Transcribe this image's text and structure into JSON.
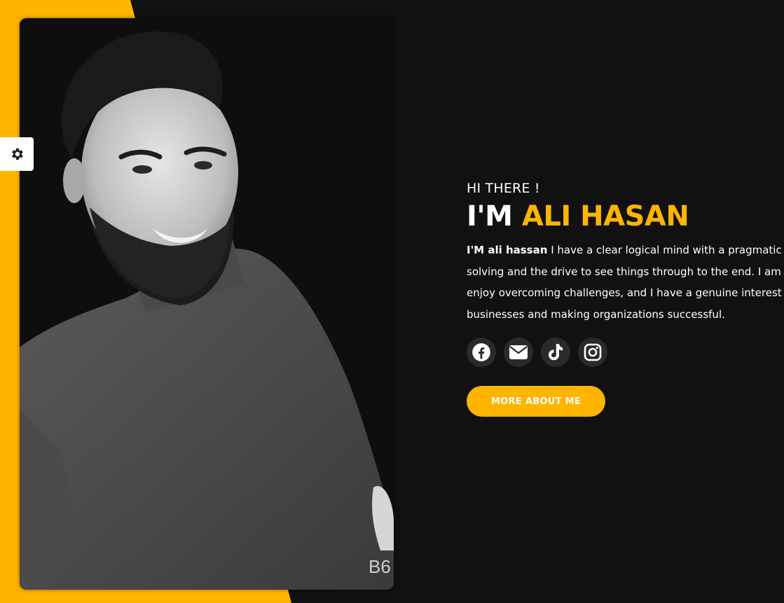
{
  "settings": {
    "icon": "gear-icon"
  },
  "photo": {
    "description_hidden": false,
    "watermark": "B6"
  },
  "hero": {
    "greeting": "HI THERE !",
    "title_prefix": "I'M",
    "title_name": "ALI HASAN",
    "bio_bold": "I'M ali hassan",
    "bio_lines": [
      " I have a clear logical mind with a pragmatic approach to problem",
      "solving and the drive to see things through to the end. I am eager to learn,",
      "enjoy overcoming challenges, and I have a genuine interest in running",
      "businesses and making organizations successful."
    ],
    "socials": [
      {
        "name": "facebook",
        "icon": "facebook-icon"
      },
      {
        "name": "email",
        "icon": "envelope-icon"
      },
      {
        "name": "tiktok",
        "icon": "tiktok-icon"
      },
      {
        "name": "instagram",
        "icon": "instagram-icon"
      }
    ],
    "cta_label": "MORE ABOUT ME"
  },
  "colors": {
    "accent": "#ffb400",
    "background": "#111111",
    "icon_bg": "#2a2a2a"
  }
}
